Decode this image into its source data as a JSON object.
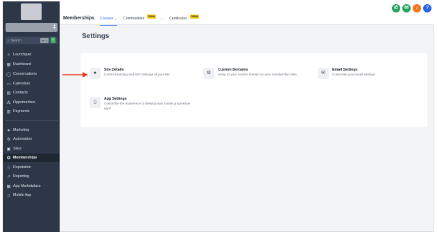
{
  "sidebar": {
    "search_placeholder": "Search",
    "search_kbd": "ctrl K",
    "search_plus": "+",
    "items": [
      {
        "label": "Launchpad",
        "icon": "rocket-icon",
        "glyph": "✧"
      },
      {
        "label": "Dashboard",
        "icon": "dashboard-icon",
        "glyph": "▦"
      },
      {
        "label": "Conversations",
        "icon": "chat-icon",
        "glyph": "◯"
      },
      {
        "label": "Calendars",
        "icon": "calendar-icon",
        "glyph": "▭"
      },
      {
        "label": "Contacts",
        "icon": "contacts-icon",
        "glyph": "▤"
      },
      {
        "label": "Opportunities",
        "icon": "opportunities-icon",
        "glyph": "⁂"
      },
      {
        "label": "Payments",
        "icon": "payments-icon",
        "glyph": "▥"
      },
      {
        "label": "Marketing",
        "icon": "marketing-icon",
        "glyph": "➤"
      },
      {
        "label": "Automation",
        "icon": "automation-icon",
        "glyph": "⚙"
      },
      {
        "label": "Sites",
        "icon": "sites-icon",
        "glyph": "▣"
      },
      {
        "label": "Memberships",
        "icon": "memberships-icon",
        "glyph": "✪"
      },
      {
        "label": "Reputation",
        "icon": "star-icon",
        "glyph": "☆"
      },
      {
        "label": "Reporting",
        "icon": "reporting-icon",
        "glyph": "↗"
      },
      {
        "label": "App Marketplace",
        "icon": "marketplace-icon",
        "glyph": "▩"
      },
      {
        "label": "Mobile App",
        "icon": "mobile-icon",
        "glyph": "▯"
      }
    ]
  },
  "header": {
    "title": "Memberships",
    "tabs": [
      {
        "label": "Courses",
        "active": true
      },
      {
        "label": "Communities",
        "badge": "New"
      },
      {
        "label": "Certificates",
        "badge": "New"
      }
    ],
    "actions": [
      {
        "icon": "phone-icon",
        "glyph": "✆",
        "color": "#22a35a"
      },
      {
        "icon": "megaphone-icon",
        "glyph": "✉",
        "color": "#22a35a"
      },
      {
        "icon": "bell-icon",
        "glyph": "♪",
        "color": "#f97316"
      },
      {
        "icon": "help-icon",
        "glyph": "?",
        "color": "#2563eb"
      }
    ]
  },
  "main": {
    "title": "Settings",
    "settings": [
      {
        "title": "Site Details",
        "desc": "Control branding and SEO settings of your site",
        "icon": "globe-icon",
        "glyph": "●"
      },
      {
        "title": "Custom Domains",
        "desc": "Setup to your custom domain on your membership sites",
        "icon": "gear-icon",
        "glyph": "⚙"
      },
      {
        "title": "Email Settings",
        "desc": "Customise your email settings",
        "icon": "mail-icon",
        "glyph": "✉"
      },
      {
        "title": "App Settings",
        "desc": "Customise the experience of desktop and mobile progressive apps",
        "icon": "mobile-icon",
        "glyph": "▯"
      }
    ]
  },
  "colors": {
    "accent": "#2563eb",
    "sidebar_bg": "#2d3748",
    "arrow": "#e53e1e"
  }
}
